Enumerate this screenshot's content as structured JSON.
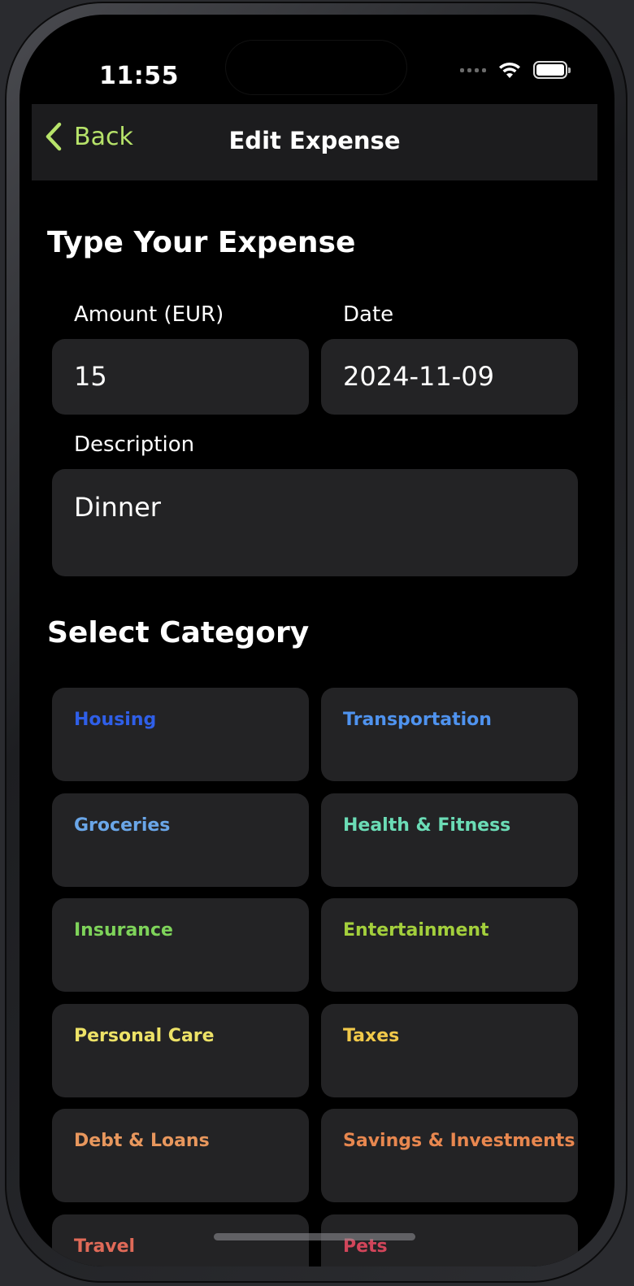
{
  "status_bar": {
    "time": "11:55"
  },
  "navbar": {
    "back_label": "Back",
    "title": "Edit Expense"
  },
  "expense_section": {
    "title": "Type Your Expense",
    "amount_label": "Amount (EUR)",
    "amount_value": "15",
    "date_label": "Date",
    "date_value": "2024-11-09",
    "description_label": "Description",
    "description_value": "Dinner"
  },
  "category_section": {
    "title": "Select Category",
    "items": [
      {
        "label": "Housing",
        "color": "#2f5fe8"
      },
      {
        "label": "Transportation",
        "color": "#4f93ef"
      },
      {
        "label": "Groceries",
        "color": "#6aa6e8"
      },
      {
        "label": "Health & Fitness",
        "color": "#6bdcb6"
      },
      {
        "label": "Insurance",
        "color": "#7ed35a"
      },
      {
        "label": "Entertainment",
        "color": "#a3cf3c"
      },
      {
        "label": "Personal Care",
        "color": "#ede267"
      },
      {
        "label": "Taxes",
        "color": "#f1c94a"
      },
      {
        "label": "Debt & Loans",
        "color": "#e8975d"
      },
      {
        "label": "Savings & Investments",
        "color": "#e8874f"
      },
      {
        "label": "Travel",
        "color": "#e06a58"
      },
      {
        "label": "Pets",
        "color": "#d2455a"
      }
    ]
  },
  "colors": {
    "accent": "#b7e36a",
    "card": "#232325",
    "background": "#000000"
  }
}
